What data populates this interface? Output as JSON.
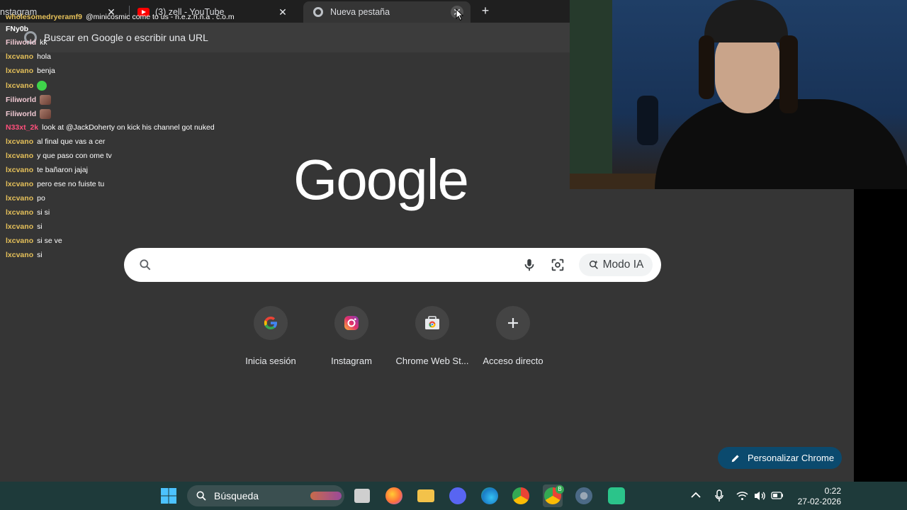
{
  "browser": {
    "tabs": [
      {
        "title": "nstagram",
        "close": "✕"
      },
      {
        "title": "(3) zell - YouTube",
        "close": "✕"
      },
      {
        "title": "Nueva pestaña",
        "close": "✕"
      }
    ],
    "new_tab": "+",
    "omnibox_placeholder": "Buscar en Google o escribir una URL"
  },
  "chat": [
    {
      "user": "wholesomedryeramf9",
      "message": "@minicosmic come to us - n.e.z.h.n.a . c.o.m",
      "color": "yellow"
    },
    {
      "user": "",
      "message": "FNy0b",
      "color": "white"
    },
    {
      "user": "Filiworld",
      "message": "kk",
      "color": "pink"
    },
    {
      "user": "lxcvano",
      "message": "hola",
      "color": "yellow"
    },
    {
      "user": "lxcvano",
      "message": "benja",
      "color": "yellow"
    },
    {
      "user": "lxcvano",
      "message": "",
      "emote": "green",
      "color": "yellow"
    },
    {
      "user": "Filiworld",
      "message": "",
      "emote": "face",
      "color": "pink"
    },
    {
      "user": "Filiworld",
      "message": "",
      "emote": "face",
      "color": "pink"
    },
    {
      "user": "N33xt_2k",
      "message": "look at @JackDoherty on kick his channel got nuked",
      "color": "red"
    },
    {
      "user": "lxcvano",
      "message": "al final que vas a cer",
      "color": "yellow"
    },
    {
      "user": "lxcvano",
      "message": "y que paso con ome tv",
      "color": "yellow"
    },
    {
      "user": "lxcvano",
      "message": "te bañaron jajaj",
      "color": "yellow"
    },
    {
      "user": "lxcvano",
      "message": "pero ese no fuiste tu",
      "color": "yellow"
    },
    {
      "user": "lxcvano",
      "message": "po",
      "color": "yellow"
    },
    {
      "user": "lxcvano",
      "message": "si si",
      "color": "yellow"
    },
    {
      "user": "lxcvano",
      "message": "si",
      "color": "yellow"
    },
    {
      "user": "lxcvano",
      "message": "si se ve",
      "color": "yellow"
    },
    {
      "user": "lxcvano",
      "message": "si",
      "color": "yellow"
    }
  ],
  "newtab": {
    "logo": "Google",
    "search_placeholder": "",
    "ai_mode_label": "Modo IA",
    "shortcuts": [
      {
        "label": "Inicia sesión",
        "icon": "google-icon"
      },
      {
        "label": "Instagram",
        "icon": "instagram-icon"
      },
      {
        "label": "Chrome Web St...",
        "icon": "chrome-web-store-icon"
      },
      {
        "label": "Acceso directo",
        "icon": "plus-icon"
      }
    ],
    "customize_label": "Personalizar Chrome"
  },
  "taskbar": {
    "search_label": "Búsqueda",
    "time": "0:22",
    "date": "27-02-2026",
    "chrome_badge": "B"
  },
  "colors": {
    "page_bg": "#353535",
    "tabstrip_bg": "#1f1f1f",
    "accent_button": "#0b4a6e",
    "taskbar_bg": "#1e3a3a",
    "chat_user_yellow": "#e6c15a",
    "chat_user_pink": "#f0c8d2",
    "chat_user_red": "#ff4f7b"
  }
}
